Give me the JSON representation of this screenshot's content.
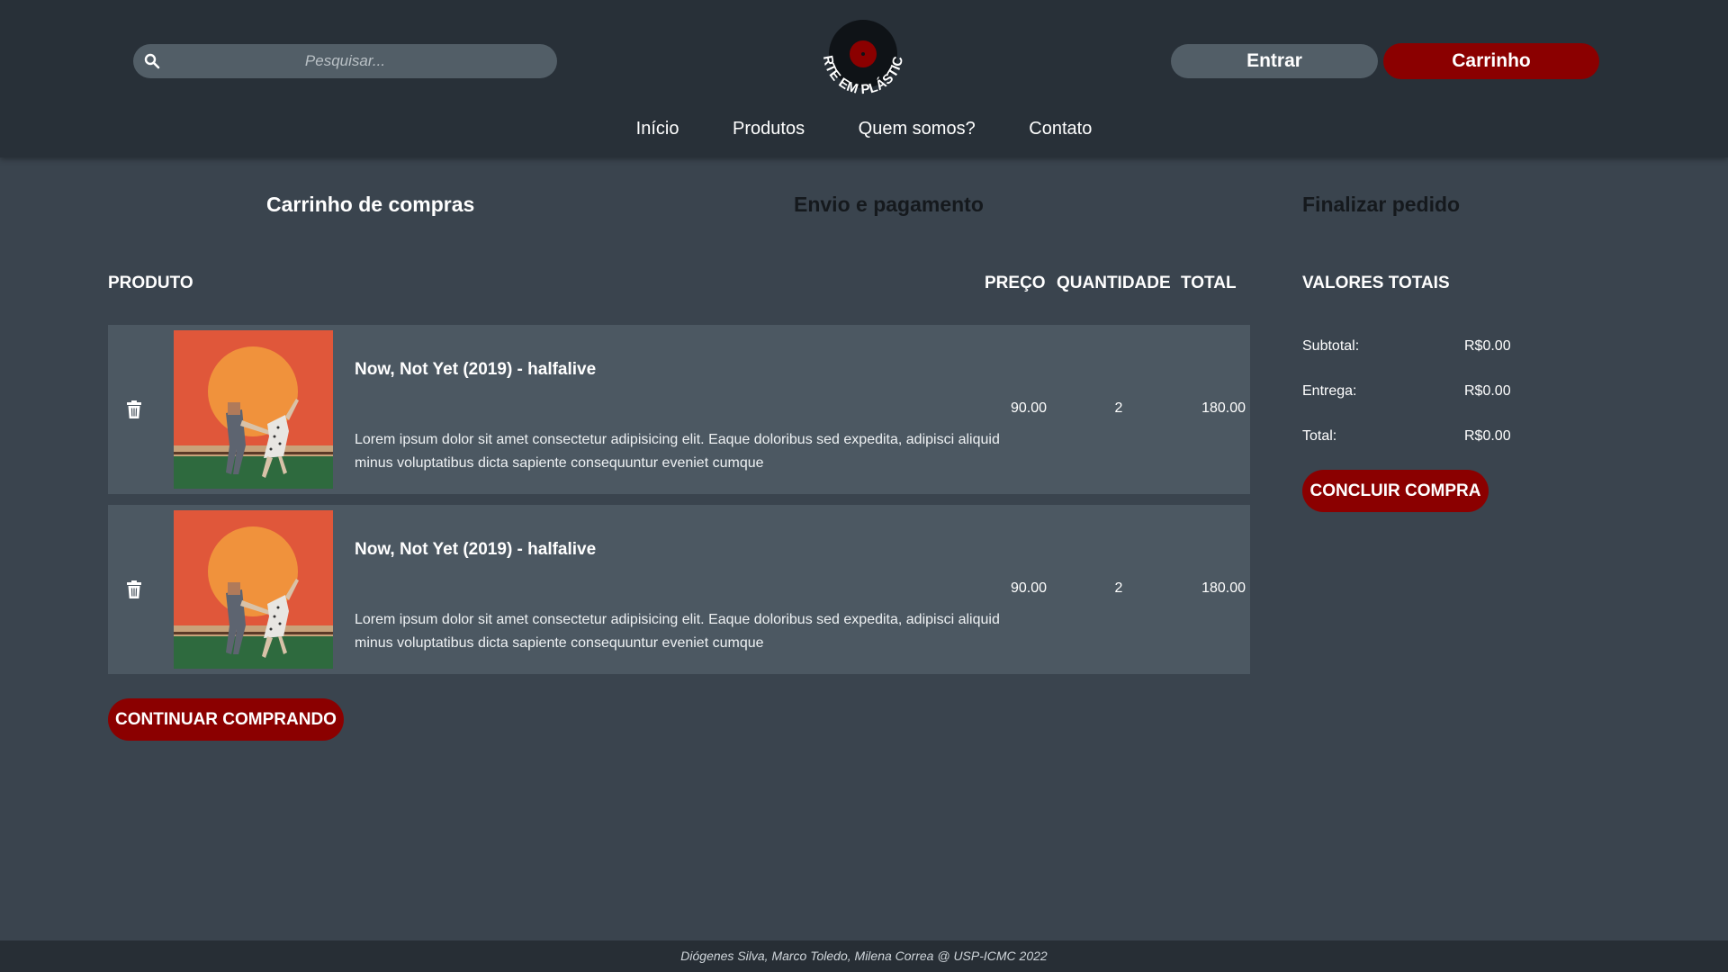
{
  "header": {
    "search_placeholder": "Pesquisar...",
    "logo_text": "ARTE EM PLÁSTICO",
    "login_label": "Entrar",
    "cart_label": "Carrinho",
    "nav": [
      "Início",
      "Produtos",
      "Quem somos?",
      "Contato"
    ]
  },
  "steps": [
    "Carrinho de compras",
    "Envio e pagamento",
    "Finalizar pedido"
  ],
  "table": {
    "headers": {
      "product": "PRODUTO",
      "price": "PREÇO",
      "quantity": "QUANTIDADE",
      "total": "TOTAL"
    },
    "items": [
      {
        "title": "Now, Not Yet (2019) - halfalive",
        "description": "Lorem ipsum dolor sit amet consectetur adipisicing elit. Eaque doloribus sed expedita, adipisci aliquid minus voluptatibus dicta sapiente consequuntur eveniet cumque",
        "price": "90.00",
        "quantity": "2",
        "total": "180.00"
      },
      {
        "title": "Now, Not Yet (2019) - halfalive",
        "description": "Lorem ipsum dolor sit amet consectetur adipisicing elit. Eaque doloribus sed expedita, adipisci aliquid minus voluptatibus dicta sapiente consequuntur eveniet cumque",
        "price": "90.00",
        "quantity": "2",
        "total": "180.00"
      }
    ],
    "continue_label": "CONTINUAR COMPRANDO"
  },
  "summary": {
    "title": "VALORES TOTAIS",
    "subtotal_label": "Subtotal:",
    "subtotal_value": "R$0.00",
    "shipping_label": "Entrega:",
    "shipping_value": "R$0.00",
    "total_label": "Total:",
    "total_value": "R$0.00",
    "finish_label": "CONCLUIR COMPRA"
  },
  "footer": {
    "text": "Diógenes Silva, Marco Toledo, Milena Correa @ USP-ICMC 2022"
  },
  "colors": {
    "accent": "#8b0000",
    "header_bg": "#283038",
    "page_bg": "#3a444e",
    "row_bg": "#4c5862"
  }
}
